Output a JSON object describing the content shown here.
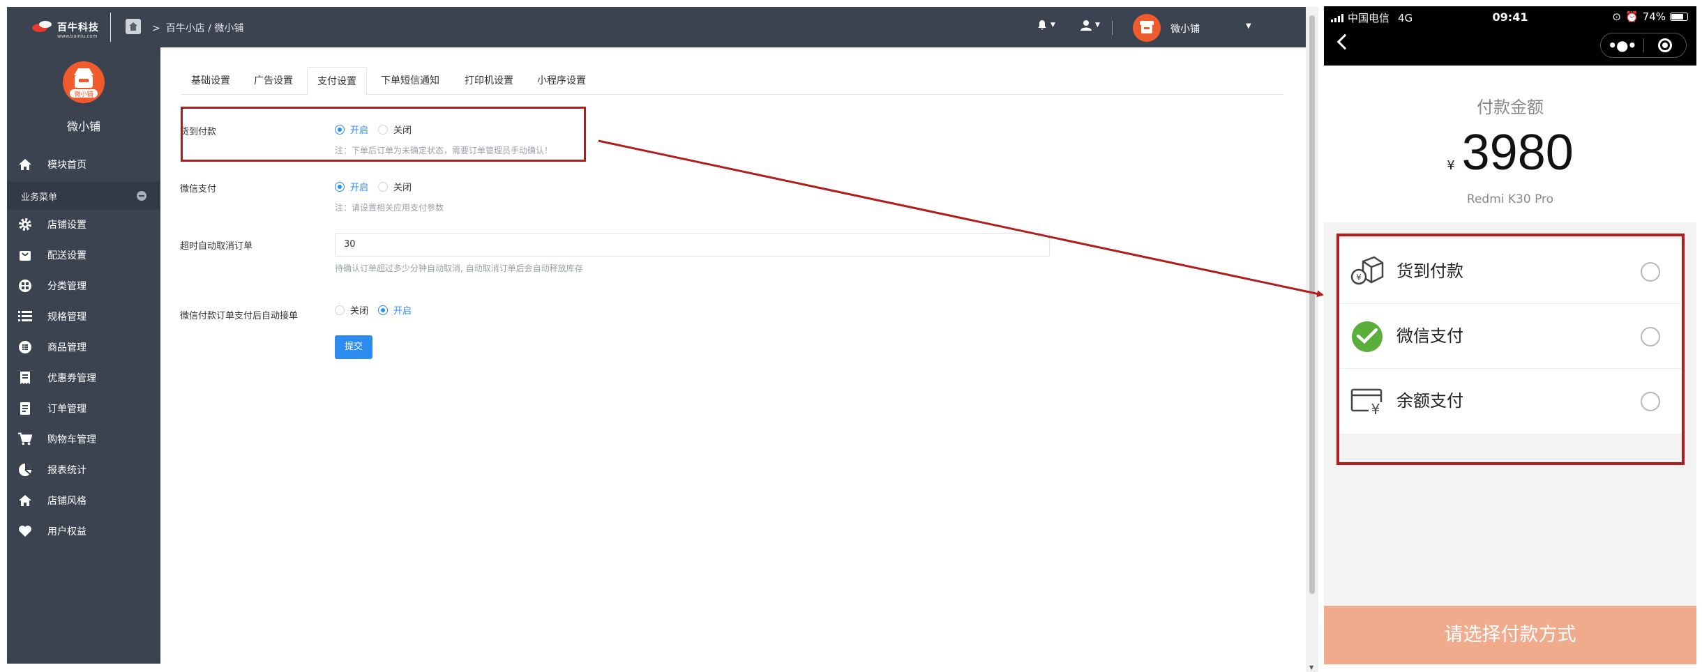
{
  "admin": {
    "brand": {
      "logo_text": "百牛科技",
      "logo_sub": "www.bainiu.com"
    },
    "breadcrumb": "百牛小店 / 微小铺",
    "top_user": {
      "name": "微小铺"
    },
    "sidebar": {
      "avatar_label": "微小铺",
      "shop_name": "微小铺",
      "top_item": "模块首页",
      "group_label": "业务菜单",
      "items": [
        {
          "label": "店铺设置",
          "icon": "gear-icon"
        },
        {
          "label": "配送设置",
          "icon": "bag-icon"
        },
        {
          "label": "分类管理",
          "icon": "grid-icon"
        },
        {
          "label": "规格管理",
          "icon": "list-icon"
        },
        {
          "label": "商品管理",
          "icon": "goods-icon"
        },
        {
          "label": "优惠券管理",
          "icon": "coupon-icon"
        },
        {
          "label": "订单管理",
          "icon": "order-icon"
        },
        {
          "label": "购物车管理",
          "icon": "cart-icon"
        },
        {
          "label": "报表统计",
          "icon": "pie-icon"
        },
        {
          "label": "店铺风格",
          "icon": "home-icon"
        },
        {
          "label": "用户权益",
          "icon": "heart-icon"
        }
      ]
    },
    "tabs": [
      "基础设置",
      "广告设置",
      "支付设置",
      "下单短信通知",
      "打印机设置",
      "小程序设置"
    ],
    "active_tab": "支付设置",
    "form": {
      "cod": {
        "label": "货到付款",
        "on": "开启",
        "off": "关闭",
        "note": "注：下单后订单为未确定状态，需要订单管理员手动确认！"
      },
      "wechat": {
        "label": "微信支付",
        "on": "开启",
        "off": "关闭",
        "note": "注：请设置相关应用支付参数"
      },
      "timeout": {
        "label": "超时自动取消订单",
        "value": "30",
        "note": "待确认订单超过多少分钟自动取消, 自动取消订单后会自动释放库存"
      },
      "auto_accept": {
        "label": "微信付款订单支付后自动接单",
        "off": "关闭",
        "on": "开启"
      },
      "submit": "提交"
    }
  },
  "phone": {
    "status": {
      "carrier": "中国电信",
      "network": "4G",
      "time": "09:41",
      "battery": "74%"
    },
    "pay_title": "付款金额",
    "currency": "¥",
    "amount": "3980",
    "product": "Redmi K30 Pro",
    "methods": [
      {
        "label": "货到付款",
        "icon": "cod-box-icon"
      },
      {
        "label": "微信支付",
        "icon": "wechat-pay-icon"
      },
      {
        "label": "余额支付",
        "icon": "balance-card-icon"
      }
    ],
    "bottom_button": "请选择付款方式"
  },
  "colors": {
    "sidebar_bg": "#3b4250",
    "accent_blue": "#2d8cf0",
    "highlight_red": "#b11d1d",
    "pay_button": "#f0ab8c",
    "brand_orange": "#ef5b2c"
  }
}
